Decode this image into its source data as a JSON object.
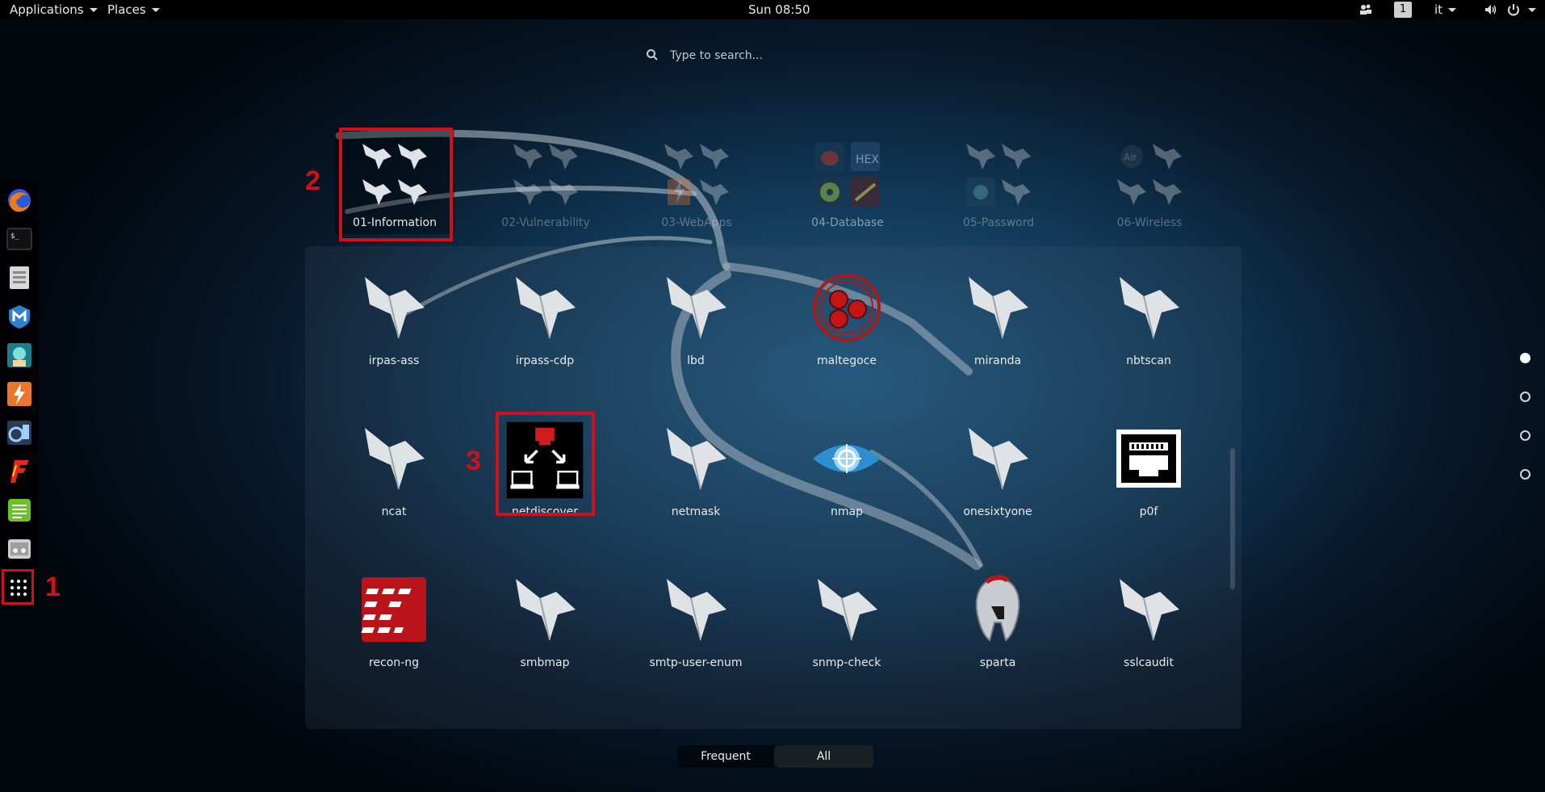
{
  "topbar": {
    "applications_label": "Applications",
    "places_label": "Places",
    "clock": "Sun 08:50",
    "workspace_number": "1",
    "keyboard_layout": "it",
    "icons": [
      "screen-share-icon",
      "volume-icon",
      "power-icon"
    ]
  },
  "search": {
    "placeholder": "Type to search..."
  },
  "dash": {
    "items": [
      "firefox-icon",
      "terminal-icon",
      "files-icon",
      "metasploit-icon",
      "armitage-icon",
      "burpsuite-icon",
      "beef-icon",
      "faraday-icon",
      "leafpad-icon",
      "cutycapt-icon"
    ],
    "show_apps_label": "Show Applications"
  },
  "categories": [
    {
      "label": "01-Information",
      "active": true
    },
    {
      "label": "02-Vulnerability",
      "active": false
    },
    {
      "label": "03-WebApps",
      "active": false
    },
    {
      "label": "04-Database",
      "active": false
    },
    {
      "label": "05-Password",
      "active": false
    },
    {
      "label": "06-Wireless",
      "active": false
    }
  ],
  "apps": [
    {
      "label": "irpas-ass",
      "icon": "kali-dragon-icon"
    },
    {
      "label": "irpass-cdp",
      "icon": "kali-dragon-icon"
    },
    {
      "label": "lbd",
      "icon": "kali-dragon-icon"
    },
    {
      "label": "maltegoce",
      "icon": "maltego-icon"
    },
    {
      "label": "miranda",
      "icon": "kali-dragon-icon"
    },
    {
      "label": "nbtscan",
      "icon": "kali-dragon-icon"
    },
    {
      "label": "ncat",
      "icon": "kali-dragon-icon"
    },
    {
      "label": "netdiscover",
      "icon": "netdiscover-icon"
    },
    {
      "label": "netmask",
      "icon": "kali-dragon-icon"
    },
    {
      "label": "nmap",
      "icon": "nmap-eye-icon"
    },
    {
      "label": "onesixtyone",
      "icon": "kali-dragon-icon"
    },
    {
      "label": "p0f",
      "icon": "ethernet-port-icon"
    },
    {
      "label": "recon-ng",
      "icon": "recon-ng-icon"
    },
    {
      "label": "smbmap",
      "icon": "kali-dragon-icon"
    },
    {
      "label": "smtp-user-enum",
      "icon": "kali-dragon-icon"
    },
    {
      "label": "snmp-check",
      "icon": "kali-dragon-icon"
    },
    {
      "label": "sparta",
      "icon": "sparta-helmet-icon"
    },
    {
      "label": "sslcaudit",
      "icon": "kali-dragon-icon"
    }
  ],
  "annotations": [
    "1",
    "2",
    "3"
  ],
  "switcher": {
    "frequent_label": "Frequent",
    "all_label": "All",
    "selected": "All"
  },
  "pages": {
    "count": 4,
    "current": 1
  },
  "colors": {
    "annotation_red": "#d0101c",
    "topbar_bg": "#000000",
    "background_blue": "#1f5a82"
  }
}
